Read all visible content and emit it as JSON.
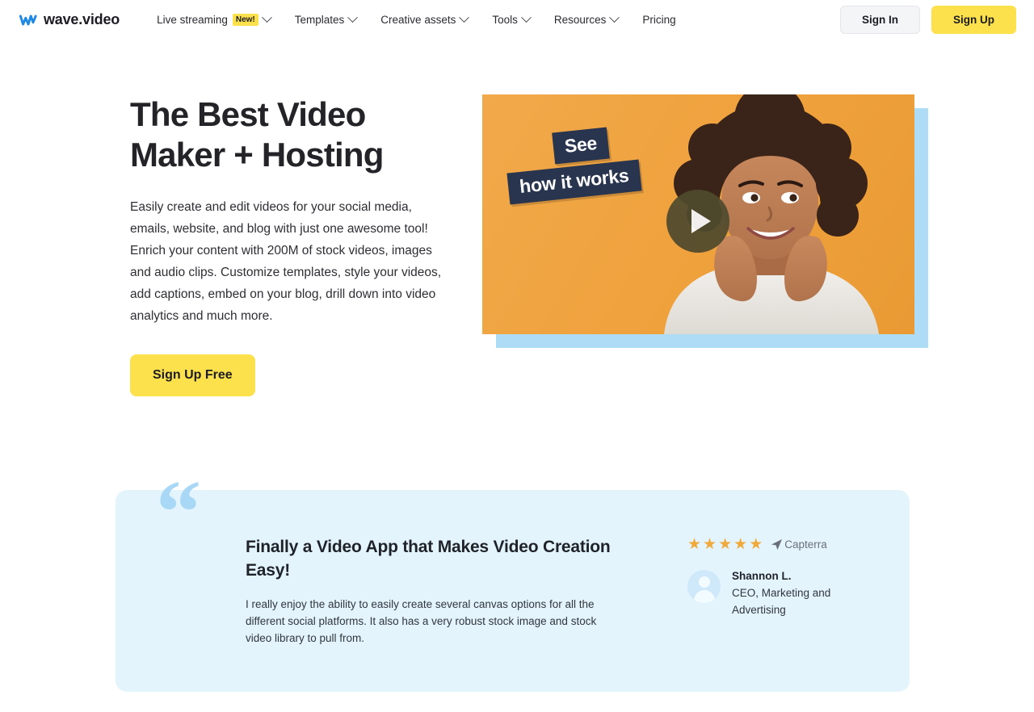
{
  "brand": {
    "logo_text": "wave.video",
    "logo_color": "#2196F3",
    "accent_yellow": "#FCE14D",
    "card_blue": "#E3F4FD",
    "quote_blue": "#A8D8F5",
    "video_orange": "#F0A440",
    "video_shadow_blue": "#AEDCF7",
    "star_orange": "#F0A93B"
  },
  "nav": {
    "items": [
      {
        "label": "Live streaming",
        "badge": "New!",
        "has_dropdown": true
      },
      {
        "label": "Templates",
        "badge": null,
        "has_dropdown": true
      },
      {
        "label": "Creative assets",
        "badge": null,
        "has_dropdown": true
      },
      {
        "label": "Tools",
        "badge": null,
        "has_dropdown": true
      },
      {
        "label": "Resources",
        "badge": null,
        "has_dropdown": true
      },
      {
        "label": "Pricing",
        "badge": null,
        "has_dropdown": false
      }
    ],
    "sign_in": "Sign In",
    "sign_up": "Sign Up"
  },
  "hero": {
    "title_line1": "The Best Video",
    "title_line2": "Maker + Hosting",
    "paragraph1": "Easily create and edit videos for your social media, emails, website, and blog with just one awesome tool!",
    "paragraph2": "Enrich your content with 200M of stock videos, images and audio clips. Customize templates, style your videos, add captions, embed on your blog, drill down into video analytics and much more.",
    "cta": "Sign Up Free",
    "video": {
      "badge_line1": "See",
      "badge_line2": "how it works",
      "play_label": "Play video"
    }
  },
  "testimonial": {
    "quote_glyph": "“",
    "heading": "Finally a Video App that Makes Video Creation Easy!",
    "body": "I really enjoy the ability to easily create several canvas options for all the different social platforms. It also has a very robust stock image and stock video library to pull from.",
    "rating": 5,
    "star_glyph": "★",
    "source": "Capterra",
    "author_name": "Shannon L.",
    "author_role": "CEO, Marketing and Advertising"
  }
}
